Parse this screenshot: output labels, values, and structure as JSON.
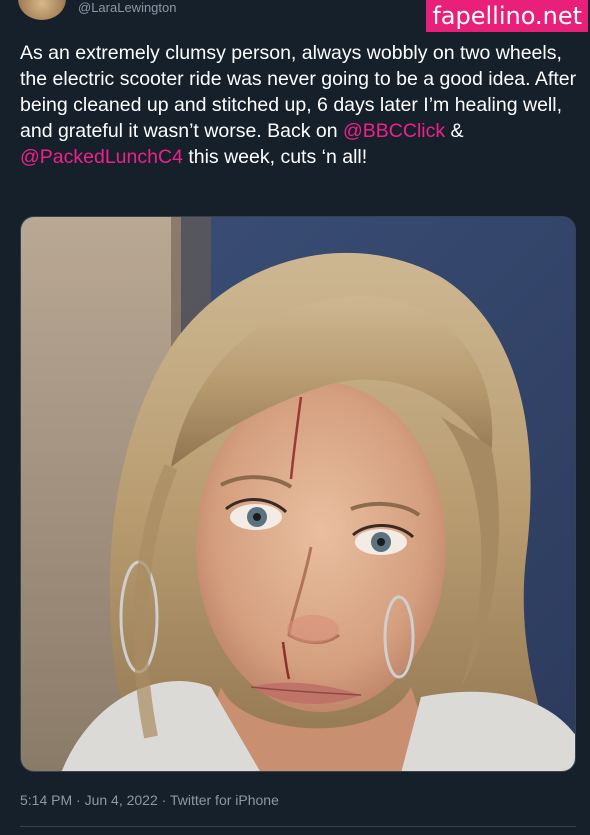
{
  "tweet": {
    "handle": "@LaraLewington",
    "text_part1": "As an extremely clumsy person, always wobbly on two wheels, the electric scooter ride was never going to be a good idea. After being cleaned up and stitched up, 6 days later I’m healing well, and grateful it wasn’t worse. Back on ",
    "mention1": "@BBCClick",
    "text_part2": " & ",
    "mention2": "@PackedLunchC4",
    "text_part3": " this week, cuts ‘n all!",
    "timestamp": "5:14 PM · Jun 4, 2022 · Twitter for iPhone"
  },
  "watermark": {
    "text": "fapellino.net"
  },
  "colors": {
    "background": "#15202b",
    "mention": "#f0208a",
    "watermark_bg": "#e8207a",
    "secondary_text": "#8b98a5"
  }
}
